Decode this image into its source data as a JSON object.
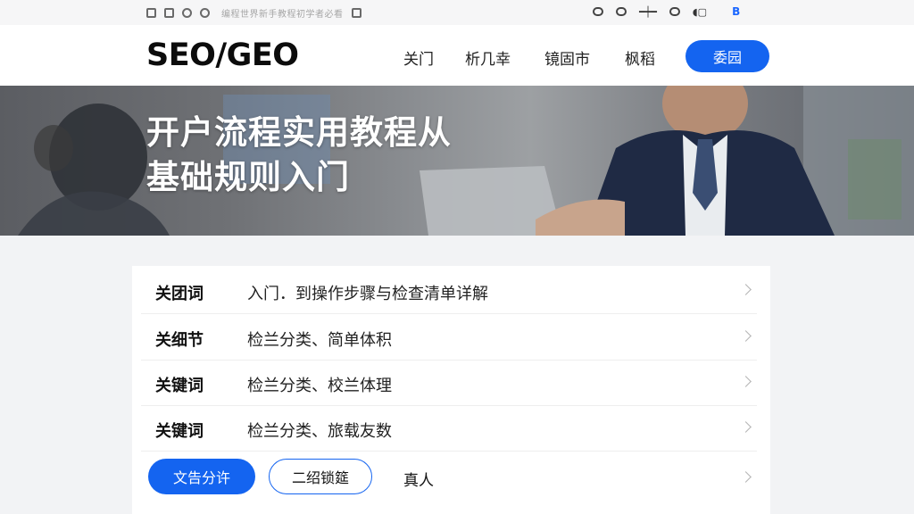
{
  "status_bar": {
    "left_icons": [
      "app-icon",
      "camera-icon",
      "cloud-icon",
      "chat-icon"
    ],
    "notification_text": "编程世界新手教程初学者必看",
    "right_icons": [
      "eye-icon",
      "record-icon",
      "signal-icon",
      "circle-icon",
      "battery-icon"
    ],
    "right_brand": "B"
  },
  "navbar": {
    "logo": "SEO/GEO",
    "links": [
      "关门",
      "析几幸",
      "镜固市",
      "枫稻"
    ],
    "cta": "委园"
  },
  "hero": {
    "title_line1": "开户流程实用教程从",
    "title_line2": "基础规则入门"
  },
  "list": {
    "rows": [
      {
        "key": "关团词",
        "desc": "入门．到操作步骤与检查清单详解"
      },
      {
        "key": "关细节",
        "desc": "检兰分类、简单体积"
      },
      {
        "key": "关键词",
        "desc": "检兰分类、校兰体理"
      },
      {
        "key": "关键词",
        "desc": "检兰分类、旅载友数"
      }
    ],
    "actions": {
      "primary": "文告分许",
      "secondary": "二绍锁筵",
      "link": "真人"
    }
  },
  "colors": {
    "accent": "#1464f0",
    "page_bg": "#f2f3f5",
    "card_bg": "#ffffff"
  }
}
